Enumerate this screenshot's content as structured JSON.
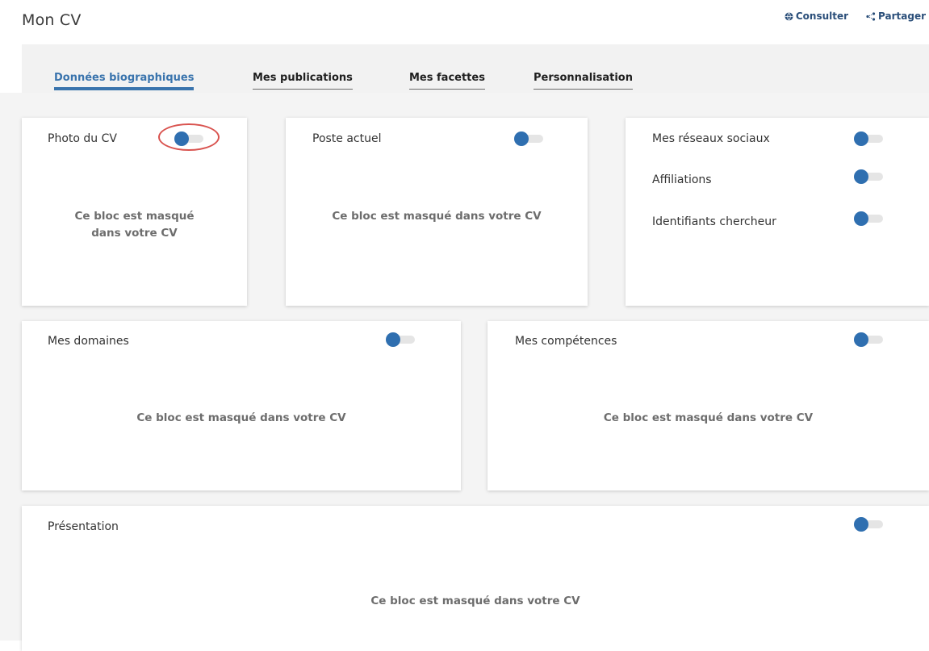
{
  "page": {
    "title": "Mon CV"
  },
  "actions": {
    "consult": {
      "label": "Consulter",
      "icon": "globe-icon"
    },
    "share": {
      "label": "Partager",
      "icon": "share-icon"
    }
  },
  "tabs": [
    {
      "label": "Données biographiques",
      "active": true
    },
    {
      "label": "Mes publications",
      "active": false
    },
    {
      "label": "Mes facettes",
      "active": false
    },
    {
      "label": "Personnalisation",
      "active": false
    }
  ],
  "masked_text": "Ce bloc est masqué dans votre CV",
  "masked_text_wrapped": [
    "Ce bloc est masqué",
    "dans votre CV"
  ],
  "cards": {
    "photo": {
      "title": "Photo du CV"
    },
    "poste": {
      "title": "Poste actuel"
    },
    "social": {
      "items": [
        {
          "label": "Mes réseaux sociaux"
        },
        {
          "label": "Affiliations"
        },
        {
          "label": "Identifiants chercheur"
        }
      ]
    },
    "domaines": {
      "title": "Mes domaines"
    },
    "competences": {
      "title": "Mes compétences"
    },
    "presentation": {
      "title": "Présentation"
    }
  },
  "colors": {
    "accent": "#3a74ad",
    "toggle_knob": "#2f6fb0",
    "highlight": "#d9534f",
    "link": "#2b4f7a"
  }
}
